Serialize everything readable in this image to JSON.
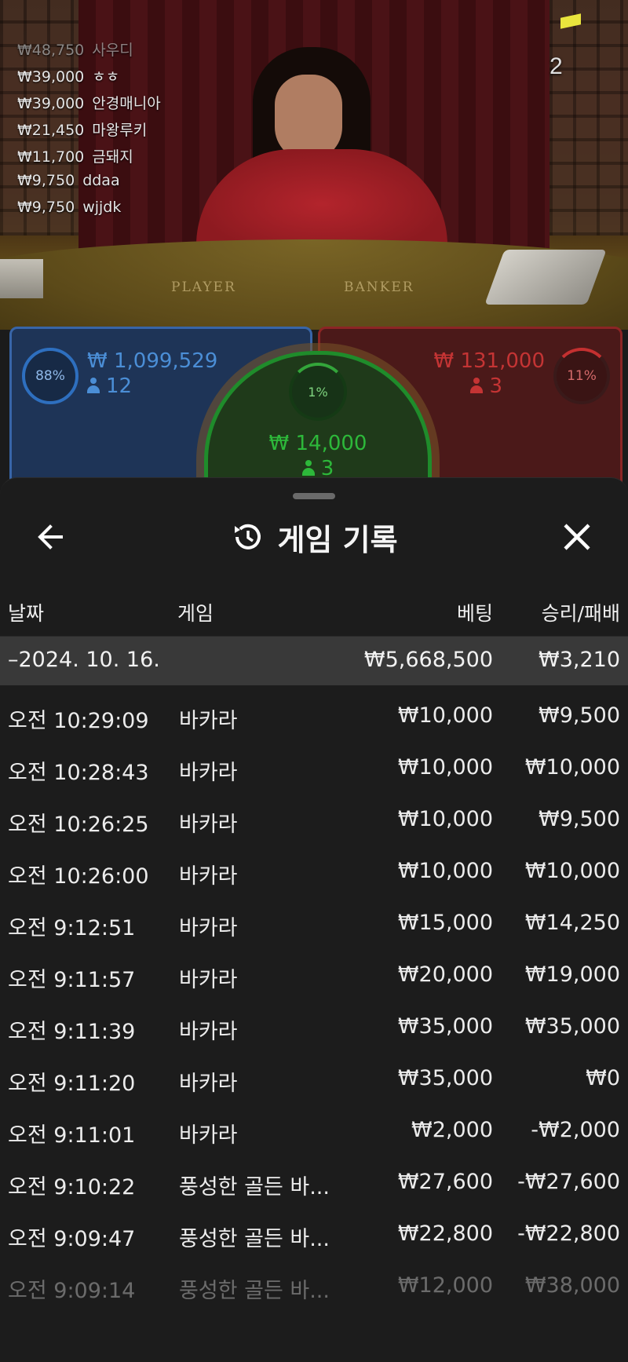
{
  "scene": {
    "table_labels": [
      "PLAYER",
      "BANKER"
    ],
    "round_number": "2"
  },
  "leaderboard": [
    {
      "amount": "₩48,750",
      "name": "사우디"
    },
    {
      "amount": "₩39,000",
      "name": "ㅎㅎ"
    },
    {
      "amount": "₩39,000",
      "name": "안경매니아"
    },
    {
      "amount": "₩21,450",
      "name": "마왕루키"
    },
    {
      "amount": "₩11,700",
      "name": "금돼지"
    },
    {
      "amount": "₩9,750",
      "name": "ddaa"
    },
    {
      "amount": "₩9,750",
      "name": "wjjdk"
    }
  ],
  "bets": {
    "player": {
      "percent": "88%",
      "amount": "₩ 1,099,529",
      "count": "12",
      "color": "#3a78c4"
    },
    "tie": {
      "percent": "1%",
      "amount": "₩ 14,000",
      "count": "3",
      "color": "#2db83a"
    },
    "banker": {
      "percent": "11%",
      "amount": "₩ 131,000",
      "count": "3",
      "color": "#c43434"
    }
  },
  "history": {
    "title": "게임 기록",
    "icons": {
      "back": "arrow-left-icon",
      "title": "history-icon",
      "close": "close-icon"
    },
    "columns": {
      "date": "날짜",
      "game": "게임",
      "bet": "베팅",
      "result": "승리/패배"
    },
    "date_group": {
      "label": "–2024. 10. 16.",
      "total_bet": "₩5,668,500",
      "total_result": "₩3,210"
    },
    "rows": [
      {
        "time": "오전 10:29:09",
        "game": "바카라",
        "bet": "₩10,000",
        "result": "₩9,500"
      },
      {
        "time": "오전 10:28:43",
        "game": "바카라",
        "bet": "₩10,000",
        "result": "₩10,000"
      },
      {
        "time": "오전 10:26:25",
        "game": "바카라",
        "bet": "₩10,000",
        "result": "₩9,500"
      },
      {
        "time": "오전 10:26:00",
        "game": "바카라",
        "bet": "₩10,000",
        "result": "₩10,000"
      },
      {
        "time": "오전 9:12:51",
        "game": "바카라",
        "bet": "₩15,000",
        "result": "₩14,250"
      },
      {
        "time": "오전 9:11:57",
        "game": "바카라",
        "bet": "₩20,000",
        "result": "₩19,000"
      },
      {
        "time": "오전 9:11:39",
        "game": "바카라",
        "bet": "₩35,000",
        "result": "₩35,000"
      },
      {
        "time": "오전 9:11:20",
        "game": "바카라",
        "bet": "₩35,000",
        "result": "₩0"
      },
      {
        "time": "오전 9:11:01",
        "game": "바카라",
        "bet": "₩2,000",
        "result": "-₩2,000"
      },
      {
        "time": "오전 9:10:22",
        "game": "풍성한 골든 바...",
        "bet": "₩27,600",
        "result": "-₩27,600"
      },
      {
        "time": "오전 9:09:47",
        "game": "풍성한 골든 바...",
        "bet": "₩22,800",
        "result": "-₩22,800"
      },
      {
        "time": "오전 9:09:14",
        "game": "풍성한 골든 바...",
        "bet": "₩12,000",
        "result": "₩38,000"
      }
    ]
  }
}
